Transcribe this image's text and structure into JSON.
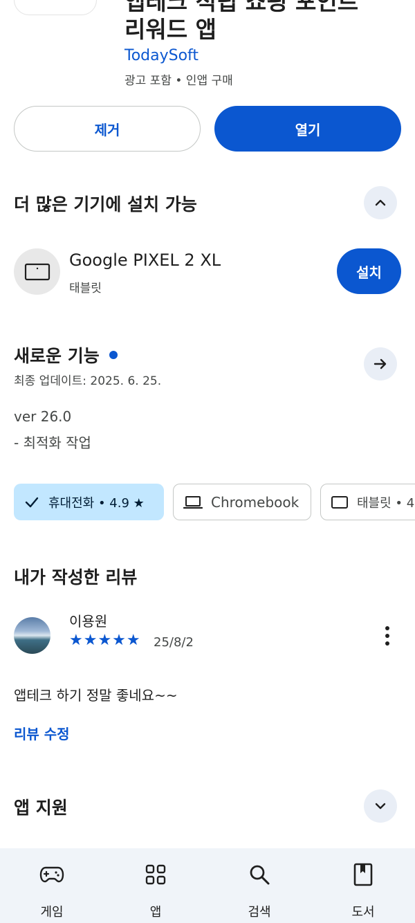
{
  "app": {
    "title_top_partial": "앱테크 적립 쇼핑 포인트",
    "title_line2": "리워드 앱",
    "developer": "TodaySoft",
    "meta": "광고 포함 • 인앱 구매"
  },
  "actions": {
    "uninstall_label": "제거",
    "open_label": "열기"
  },
  "more_devices": {
    "title": "더 많은 기기에 설치 가능",
    "device_name": "Google PIXEL 2 XL",
    "device_type": "태블릿",
    "install_label": "설치",
    "collapse_icon": "chevron-up-icon"
  },
  "whats_new": {
    "title": "새로운 기능",
    "updated": "최종 업데이트: 2025. 6. 25.",
    "version": "ver 26.0",
    "note": "- 최적화 작업"
  },
  "device_chips": [
    {
      "label": "휴대전화 • 4.9 ★",
      "icon": "check-icon",
      "selected": true
    },
    {
      "label": "Chromebook",
      "icon": "laptop-icon",
      "selected": false
    },
    {
      "label": "태블릿 • 4",
      "icon": "tablet-icon",
      "selected": false
    }
  ],
  "my_review": {
    "title": "내가 작성한 리뷰",
    "reviewer": "이용원",
    "rating": 5,
    "stars": "★★★★★",
    "date": "25/8/2",
    "text": "앱테크 하기 정말 좋네요~~",
    "edit_label": "리뷰 수정"
  },
  "app_support": {
    "title": "앱 지원",
    "expand_icon": "chevron-down-icon"
  },
  "bottom_nav": [
    {
      "label": "게임",
      "icon": "gamepad-icon"
    },
    {
      "label": "앱",
      "icon": "apps-grid-icon"
    },
    {
      "label": "검색",
      "icon": "search-icon"
    },
    {
      "label": "도서",
      "icon": "book-icon"
    }
  ],
  "colors": {
    "accent": "#0b57d0",
    "chip_selected_bg": "#c2e7ff",
    "nav_bg": "#f0f4f9"
  }
}
